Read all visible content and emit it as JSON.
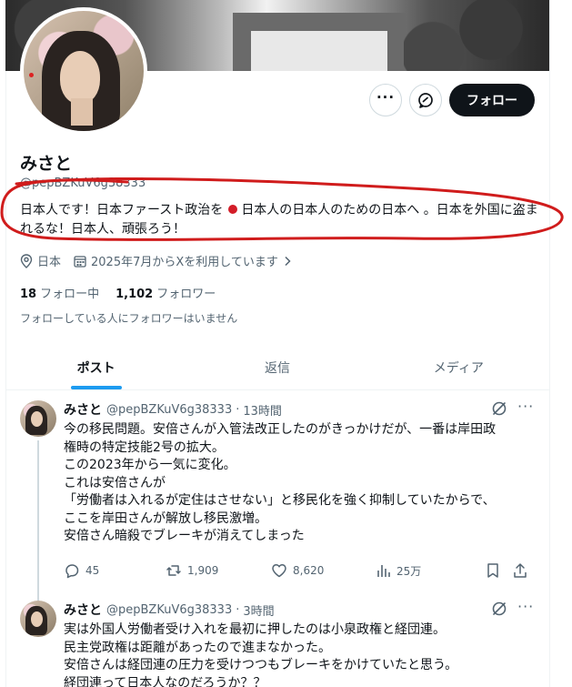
{
  "profile": {
    "name": "みさと",
    "handle": "@pepBZKuV6g38333",
    "bio_part1": "日本人です！日本ファースト政治を",
    "bio_part2": "日本人の日本人のための日本へ 。日本を外国に盗まれるな！日本人、頑張ろう！",
    "location": "日本",
    "joined": "2025年7月からXを利用しています",
    "following_count": "18",
    "following_label": "フォロー中",
    "followers_count": "1,102",
    "followers_label": "フォロワー",
    "followers_note": "フォローしている人にフォロワーはいません"
  },
  "buttons": {
    "follow_label": "フォロー",
    "more_label": "···"
  },
  "tabs": [
    {
      "label": "ポスト"
    },
    {
      "label": "返信"
    },
    {
      "label": "メディア"
    }
  ],
  "posts": [
    {
      "name": "みさと",
      "handle": "@pepBZKuV6g38333",
      "time": "13時間",
      "lines": [
        "今の移民問題。安倍さんが入管法改正したのがきっかけだが、一番は岸田政",
        "権時の特定技能2号の拡大。",
        "この2023年から一気に変化。",
        "これは安倍さんが",
        "「労働者は入れるが定住はさせない」と移民化を強く抑制していたからで、",
        "ここを岸田さんが解放し移民激増。",
        "安倍さん暗殺でブレーキが消えてしまった"
      ],
      "replies": "45",
      "reposts": "1,909",
      "likes": "8,620",
      "views": "25万"
    },
    {
      "name": "みさと",
      "handle": "@pepBZKuV6g38333",
      "time": "3時間",
      "lines": [
        "実は外国人労働者受け入れを最初に押したのは小泉政権と経団連。",
        "民主党政権は距離があったので進まなかった。",
        "安倍さんは経団連の圧力を受けつつもブレーキをかけていたと思う。",
        "経団連って日本人なのだろうか？？"
      ]
    }
  ],
  "colors": {
    "accent": "#1d9bf0",
    "text": "#0f1419",
    "secondary": "#536471",
    "annotation": "#d01c1c",
    "flag": "#d31d28"
  }
}
